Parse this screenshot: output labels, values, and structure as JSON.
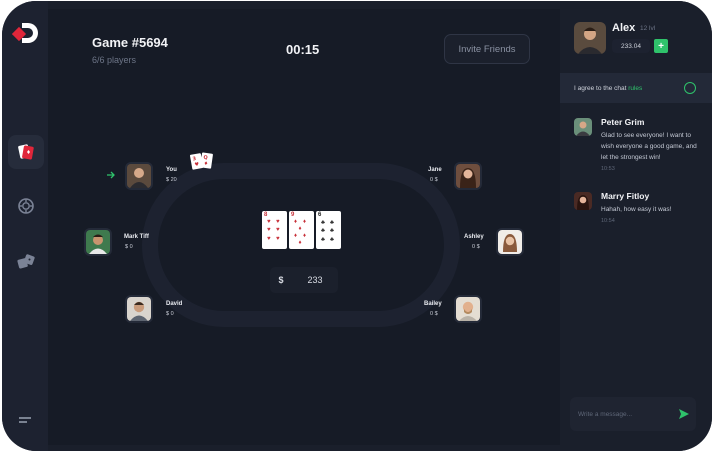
{
  "game": {
    "title": "Game #5694",
    "players": "6/6 players",
    "timer": "00:15",
    "invite_label": "Invite Friends"
  },
  "table": {
    "pot_symbol": "$",
    "pot_amount": "233",
    "community_cards": [
      {
        "rank": "8",
        "suit": "♥",
        "color": "#c8313a"
      },
      {
        "rank": "9",
        "suit": "♦",
        "color": "#c8313a"
      },
      {
        "rank": "6",
        "suit": "♣",
        "color": "#222222"
      }
    ],
    "player_hand": [
      {
        "rank": "3",
        "suit": "♥"
      },
      {
        "rank": "Q",
        "suit": "♦"
      }
    ]
  },
  "seats": [
    {
      "name": "You",
      "chips": "$ 20"
    },
    {
      "name": "Jane",
      "chips": "0 $"
    },
    {
      "name": "Mark Tiff",
      "chips": "$ 0"
    },
    {
      "name": "Ashley",
      "chips": "0 $"
    },
    {
      "name": "David",
      "chips": "$ 0"
    },
    {
      "name": "Bailey",
      "chips": "0 $"
    }
  ],
  "profile": {
    "name": "Alex",
    "level": "12 lvl",
    "balance": "233.04",
    "add_label": "+"
  },
  "rules": {
    "text": "I agree to the chat ",
    "link": "rules"
  },
  "messages": [
    {
      "author": "Peter Grim",
      "text": "Glad to see everyone! I want to wish everyone a good game, and let the strongest win!",
      "time": "10:53"
    },
    {
      "author": "Marry Fitloy",
      "text": "Hahah, how easy it was!",
      "time": "10:54"
    }
  ],
  "composer": {
    "placeholder": "Write a message..."
  },
  "colors": {
    "accent": "#2fc26b",
    "brand": "#e0263a",
    "background": "#161b26"
  }
}
